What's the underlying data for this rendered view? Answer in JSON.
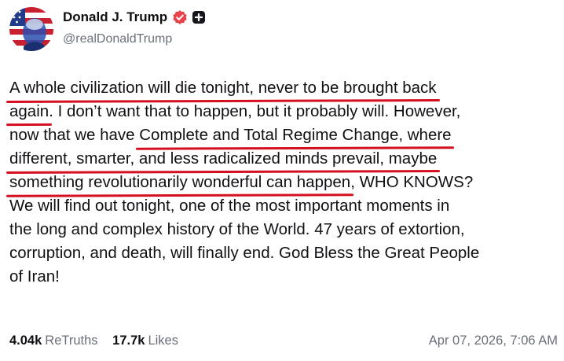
{
  "author": {
    "display_name": "Donald J. Trump",
    "handle": "@realDonaldTrump",
    "avatar_icon": "avatar-portrait-flag",
    "verified_icon": "verified-badge-icon",
    "plus_icon": "plus-badge-icon",
    "verified_color": "#e8424a"
  },
  "post": {
    "lines": [
      [
        {
          "t": "A whole civilization will die tonight, never to be brought back",
          "u": true
        }
      ],
      [
        {
          "t": "again",
          "u": true
        },
        {
          "t": ". I don’t want that to happen, but it probably will. However,",
          "u": false
        }
      ],
      [
        {
          "t": "now that we have ",
          "u": false
        },
        {
          "t": "Complete and Total Regime Change, where",
          "u": true
        }
      ],
      [
        {
          "t": "different, smarter, and less radicalized minds prevail, maybe",
          "u": true
        }
      ],
      [
        {
          "t": "something revolutionarily wonderful can happen",
          "u": true
        },
        {
          "t": ", WHO KNOWS?",
          "u": false
        }
      ],
      [
        {
          "t": "We will find out tonight, one of the most important moments in",
          "u": false
        }
      ],
      [
        {
          "t": "the long and complex history of the World. 47 years of extortion,",
          "u": false
        }
      ],
      [
        {
          "t": "corruption, and death, will finally end. God Bless the Great People",
          "u": false
        }
      ],
      [
        {
          "t": "of Iran!",
          "u": false
        }
      ]
    ],
    "underline_color": "#d40f1f"
  },
  "stats": {
    "retruths_count": "4.04k",
    "retruths_label": "ReTruths",
    "likes_count": "17.7k",
    "likes_label": "Likes"
  },
  "timestamp": "Apr 07, 2026, 7:06 AM"
}
